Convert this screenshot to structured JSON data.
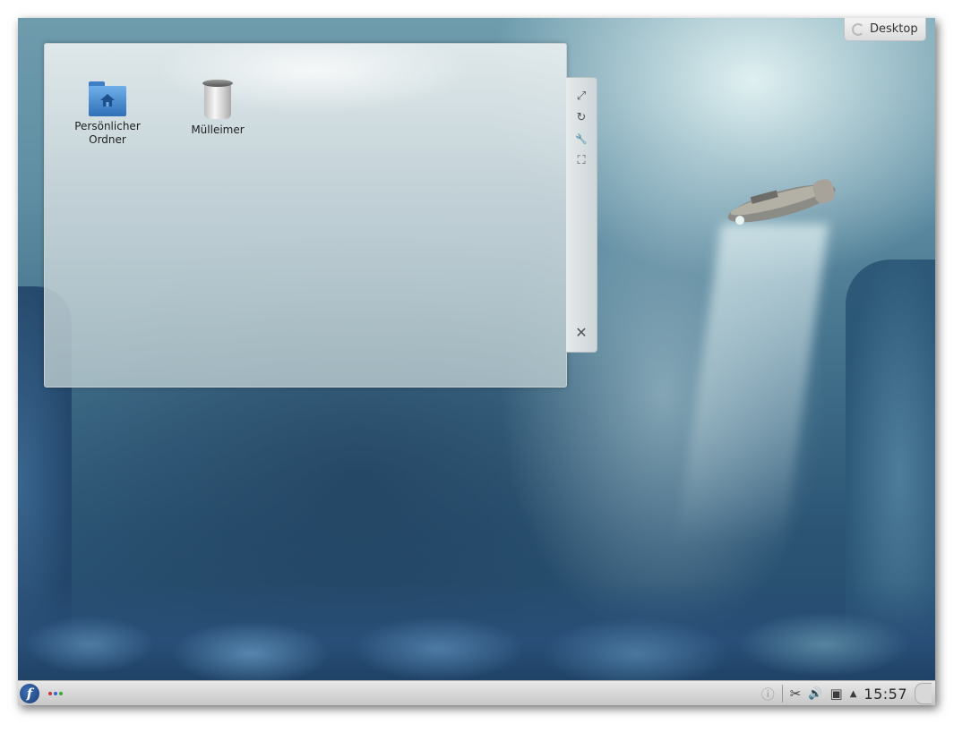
{
  "desktop_toolbox": {
    "label": "Desktop",
    "icon": "plasma-cashew-icon"
  },
  "folder_view": {
    "icons": [
      {
        "label_line1": "Persönlicher",
        "label_line2": "Ordner",
        "icon": "home-folder-icon"
      },
      {
        "label_line1": "Mülleimer",
        "label_line2": "",
        "icon": "trash-icon"
      }
    ]
  },
  "widget_handle": {
    "buttons": [
      {
        "icon": "resize-icon",
        "glyph": "⤢"
      },
      {
        "icon": "rotate-icon",
        "glyph": "↻"
      },
      {
        "icon": "settings-wrench-icon",
        "glyph": "🔧"
      },
      {
        "icon": "maximize-icon",
        "glyph": "⛶"
      },
      {
        "icon": "close-icon",
        "glyph": "✕"
      }
    ]
  },
  "panel": {
    "launcher_glyph": "f",
    "pager_colors": [
      "#cc3333",
      "#3366cc",
      "#33aa33"
    ],
    "tray": {
      "info_glyph": "ⓘ",
      "klipper_glyph": "✂",
      "volume_glyph": "🔊",
      "device_glyph": "▣",
      "expand_glyph": "▲",
      "clock": "15:57"
    }
  }
}
